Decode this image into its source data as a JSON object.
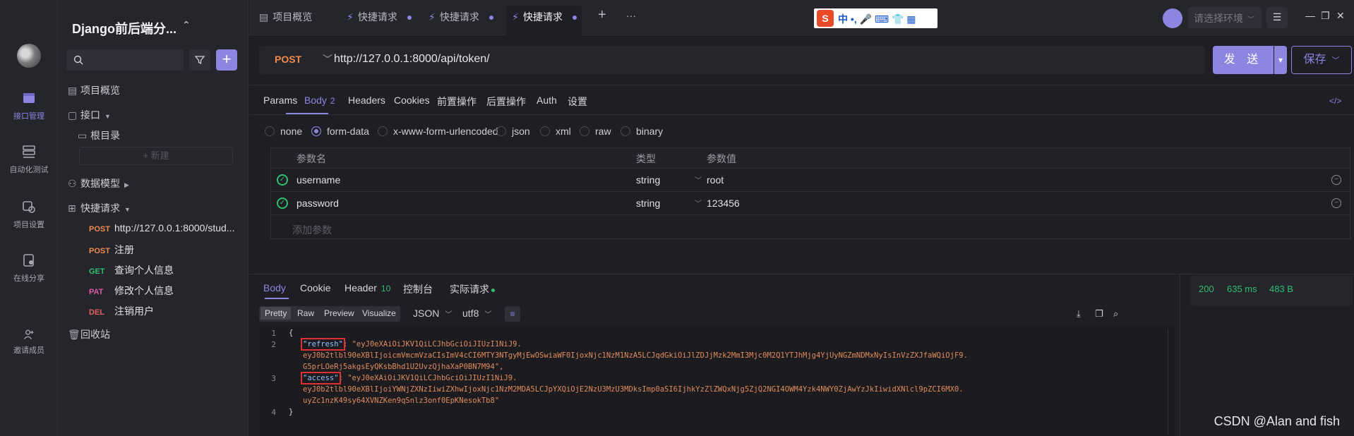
{
  "nav": {
    "items": [
      {
        "label": "接口管理",
        "icon": "api-icon"
      },
      {
        "label": "自动化测试",
        "icon": "automation-icon"
      },
      {
        "label": "项目设置",
        "icon": "settings-icon"
      },
      {
        "label": "在线分享",
        "icon": "share-icon"
      },
      {
        "label": "邀请成员",
        "icon": "invite-icon"
      }
    ]
  },
  "sidebar": {
    "project_title": "Django前后端分...",
    "new_label": "+ 新建",
    "tree": {
      "overview": "项目概览",
      "api": "接口",
      "root": "根目录",
      "data_model": "数据模型",
      "quick_requests": "快捷请求",
      "recycle": "回收站"
    },
    "requests": [
      {
        "method": "POST",
        "name": "http://127.0.0.1:8000/stud..."
      },
      {
        "method": "POST",
        "name": "注册"
      },
      {
        "method": "GET",
        "name": "查询个人信息"
      },
      {
        "method": "PAT",
        "name": "修改个人信息"
      },
      {
        "method": "DEL",
        "name": "注销用户"
      }
    ]
  },
  "tabs": [
    {
      "label": "项目概览"
    },
    {
      "label": "快捷请求"
    },
    {
      "label": "快捷请求"
    },
    {
      "label": "快捷请求"
    }
  ],
  "tab_add": "+",
  "tab_more": "···",
  "ime": {
    "logo": "S",
    "text": "中 •, 🎤 ⌨ 👕 ▦"
  },
  "env": {
    "placeholder": "请选择环境"
  },
  "request": {
    "method": "POST",
    "url": "http://127.0.0.1:8000/api/token/",
    "send_label": "发 送",
    "save_label": "保存"
  },
  "req_tabs": [
    {
      "label": "Params"
    },
    {
      "label": "Body",
      "count": "2"
    },
    {
      "label": "Headers"
    },
    {
      "label": "Cookies"
    },
    {
      "label": "前置操作"
    },
    {
      "label": "后置操作"
    },
    {
      "label": "Auth"
    },
    {
      "label": "设置"
    }
  ],
  "body_types": [
    "none",
    "form-data",
    "x-www-form-urlencoded",
    "json",
    "xml",
    "raw",
    "binary"
  ],
  "body_type_selected": "form-data",
  "params_table": {
    "headers": [
      "参数名",
      "类型",
      "参数值"
    ],
    "rows": [
      {
        "name": "username",
        "type": "string",
        "value": "root"
      },
      {
        "name": "password",
        "type": "string",
        "value": "123456"
      }
    ],
    "add_placeholder": "添加参数"
  },
  "resp_tabs": [
    {
      "label": "Body"
    },
    {
      "label": "Cookie"
    },
    {
      "label": "Header",
      "count": "10"
    },
    {
      "label": "控制台"
    },
    {
      "label": "实际请求"
    }
  ],
  "resp_formats": [
    "Pretty",
    "Raw",
    "Preview",
    "Visualize"
  ],
  "resp_lang": "JSON",
  "resp_encoding": "utf8",
  "response_code": {
    "line1": "{",
    "refresh_key": "\"refresh\"",
    "refresh_val_1": "\"eyJ0eXAiOiJKV1QiLCJhbGciOiJIUzI1NiJ9.",
    "refresh_val_2": "eyJ0b2tlbl90eXBlIjoicmVmcmVzaCIsImV4cCI6MTY3NTgyMjEwOSwiaWF0IjoxNjc1NzM1NzA5LCJqdGkiOiJlZDJjMzk2MmI3Mjc0M2Q1YTJhMjg4YjUyNGZmNDMxNyIsInVzZXJfaWQiOjF9.",
    "refresh_val_3": "G5prLOeRj5akgsEyQKsbBhd1U2UvzQjhaXaP0BN7M94\",",
    "access_key": "\"access\"",
    "access_val_1": "\"eyJ0eXAiOiJKV1QiLCJhbGciOiJIUzI1NiJ9.",
    "access_val_2": "eyJ0b2tlbl90eXBlIjoiYWNjZXNzIiwiZXhwIjoxNjc1NzM2MDA5LCJpYXQiOjE2NzU3MzU3MDksImp0aSI6IjhkYzZlZWQxNjg5ZjQ2NGI4OWM4Yzk4NWY0ZjAwYzJkIiwidXNlcl9pZCI6MX0.",
    "access_val_3": "uyZc1nzK49sy64XVNZKen9qSnlz3onf0EpKNesokTb8\"",
    "line4": "}",
    "line_numbers": [
      "1",
      "2",
      "3",
      "4"
    ]
  },
  "status": {
    "code": "200",
    "time": "635 ms",
    "size": "483 B"
  },
  "watermark": "CSDN @Alan and fish",
  "colors": {
    "accent": "#8c86e0",
    "post": "#f08a4b",
    "get": "#2fbf71",
    "success": "#2fbf71"
  }
}
